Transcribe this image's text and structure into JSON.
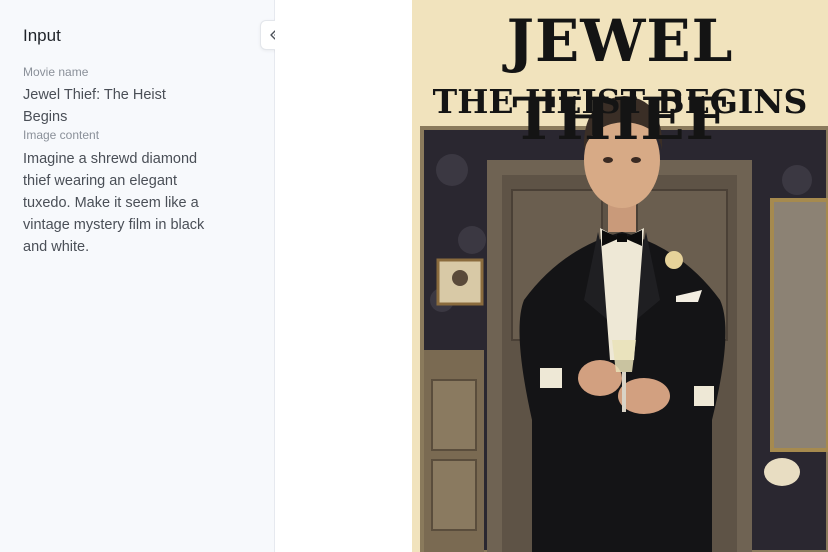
{
  "panel": {
    "title": "Input",
    "collapse_icon": "double-chevron-left-icon"
  },
  "fields": [
    {
      "label": "Movie name",
      "value": "Jewel Thief: The Heist Begins"
    },
    {
      "label": "Image content",
      "value": "Imagine a shrewd diamond thief wearing an elegant tuxedo. Make it seem like a vintage mystery film in black and white."
    }
  ],
  "poster": {
    "title_line1": "JEWEL THIEF",
    "title_line2": "THE HEIST BEGINS",
    "colors": {
      "background": "#f1e3bd",
      "title": "#141414",
      "tuxedo": "#111111"
    }
  }
}
